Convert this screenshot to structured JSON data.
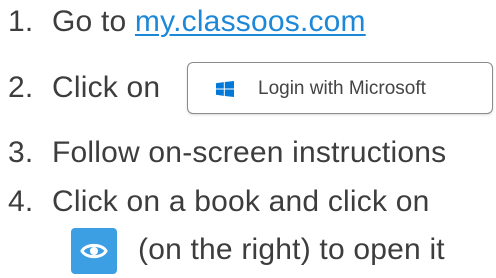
{
  "steps": [
    {
      "number": "1.",
      "text": "Go to ",
      "link": "my.classoos.com"
    },
    {
      "number": "2.",
      "text": "Click on"
    },
    {
      "number": "3.",
      "text": "Follow on-screen instructions"
    },
    {
      "number": "4.",
      "text": "Click on a book and click on"
    }
  ],
  "step4_continuation": "(on the right) to open it",
  "microsoft_button": {
    "label": "Login with Microsoft",
    "icon": "windows-logo-icon",
    "icon_color": "#0078d7"
  },
  "view_button": {
    "icon": "eye-icon",
    "background_color": "#3d9fe3"
  },
  "colors": {
    "text": "#3d3d3d",
    "link": "#1e88d8"
  }
}
